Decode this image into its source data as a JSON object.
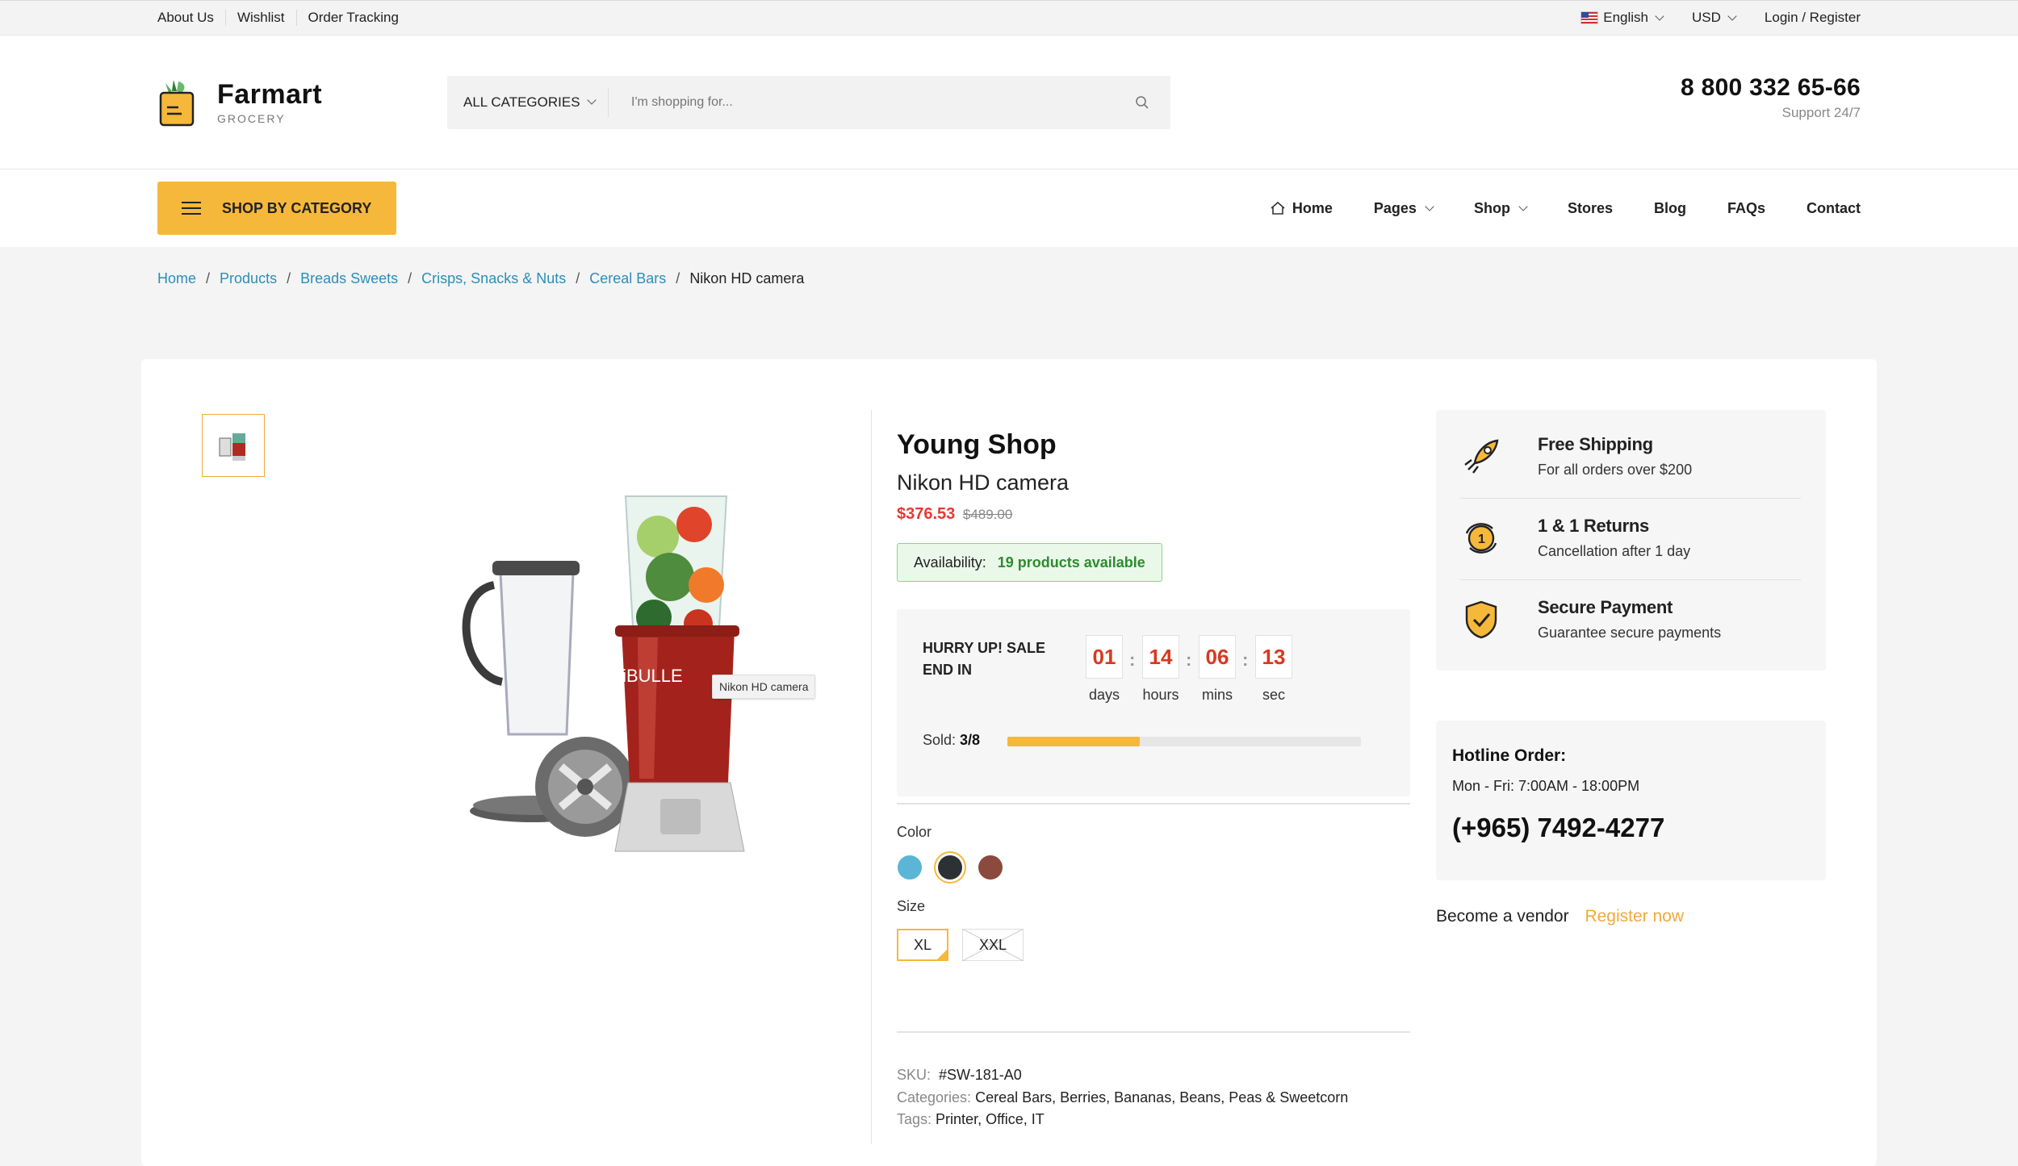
{
  "topbar": {
    "links": [
      "About Us",
      "Wishlist",
      "Order Tracking"
    ],
    "language": "English",
    "currency": "USD",
    "login": "Login / Register"
  },
  "header": {
    "logo_name": "Farmart",
    "logo_sub": "GROCERY",
    "search_category": "ALL CATEGORIES",
    "search_placeholder": "I'm shopping for...",
    "phone": "8 800 332 65-66",
    "support": "Support 24/7"
  },
  "nav": {
    "shop_by_category": "SHOP BY CATEGORY",
    "items": [
      "Home",
      "Pages",
      "Shop",
      "Stores",
      "Blog",
      "FAQs",
      "Contact"
    ]
  },
  "breadcrumb": {
    "items": [
      "Home",
      "Products",
      "Breads Sweets",
      "Crisps, Snacks & Nuts",
      "Cereal Bars"
    ],
    "current": "Nikon HD camera"
  },
  "product": {
    "image_tooltip": "Nikon HD camera",
    "store": "Young Shop",
    "name": "Nikon HD camera",
    "price": "$376.53",
    "old_price": "$489.00",
    "availability_label": "Availability:",
    "availability_value": "19 products available",
    "sale_title": "HURRY UP! SALE END IN",
    "countdown": [
      {
        "value": "01",
        "unit": "days"
      },
      {
        "value": "14",
        "unit": "hours"
      },
      {
        "value": "06",
        "unit": "mins"
      },
      {
        "value": "13",
        "unit": "sec"
      }
    ],
    "sold_label": "Sold:",
    "sold_value": "3/8",
    "sold_fraction": 0.375,
    "color_label": "Color",
    "colors": [
      "#5bb5d5",
      "#2e3133",
      "#8a4a3e"
    ],
    "selected_color_index": 1,
    "size_label": "Size",
    "sizes": [
      "XL",
      "XXL"
    ],
    "selected_size": "XL",
    "unavailable_size": "XXL",
    "sku_label": "SKU:",
    "sku": "#SW-181-A0",
    "categories_label": "Categories:",
    "categories": "Cereal Bars, Berries, Bananas, Beans, Peas & Sweetcorn",
    "tags_label": "Tags:",
    "tags": "Printer, Office, IT"
  },
  "perks": [
    {
      "icon": "rocket-icon",
      "title": "Free Shipping",
      "desc": "For all orders over $200"
    },
    {
      "icon": "returns-icon",
      "title": "1 & 1 Returns",
      "desc": "Cancellation after 1 day"
    },
    {
      "icon": "shield-check-icon",
      "title": "Secure Payment",
      "desc": "Guarantee secure payments"
    }
  ],
  "hotline": {
    "title": "Hotline Order:",
    "hours": "Mon - Fri: 7:00AM - 18:00PM",
    "phone": "(+965) 7492-4277"
  },
  "vendor": {
    "text": "Become a vendor",
    "link": "Register now"
  },
  "colors": {
    "accent": "#f6b83a",
    "link": "#2a8fb8",
    "price": "#e53935",
    "available": "#2e8b2e"
  }
}
